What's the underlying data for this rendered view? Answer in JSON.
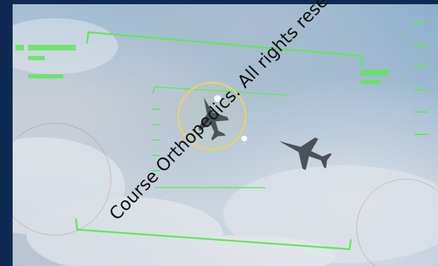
{
  "watermark": {
    "text": "Course Orthopedics. All rights reserved"
  },
  "hud": {
    "symbology_color": "#5fe85a",
    "targeting_ring_color": "#e6d468",
    "frame_color": "#0e2a52"
  },
  "icons": {
    "target_aircraft": "fighter-jet-icon",
    "wingman_aircraft": "fighter-jet-icon",
    "targeting_ring": "targeting-reticle-icon"
  }
}
